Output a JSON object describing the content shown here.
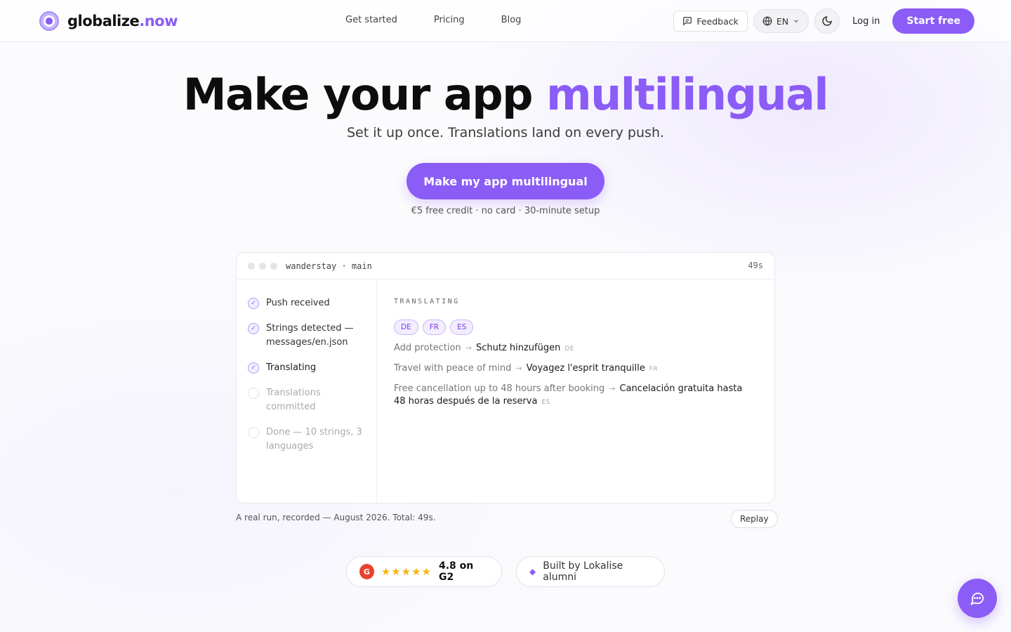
{
  "brand": {
    "name_main": "globalize",
    "name_accent": ".now"
  },
  "nav": {
    "items": [
      "Get started",
      "Pricing",
      "Blog"
    ]
  },
  "header": {
    "feedback_label": "Feedback",
    "lang_label": "EN",
    "login_label": "Log in",
    "start_label": "Start free"
  },
  "hero": {
    "title_main": "Make your app ",
    "title_accent": "multilingual",
    "subtitle": "Set it up once. Translations land on every push.",
    "cta_label": "Make my app multilingual",
    "cta_note": "€5 free credit · no card · 30-minute setup"
  },
  "demo": {
    "repo": "wanderstay · main",
    "timer": "49s",
    "steps": [
      {
        "label": "Push received",
        "state": "done"
      },
      {
        "label": "Strings detected — messages/en.json",
        "state": "done"
      },
      {
        "label": "Translating",
        "state": "active"
      },
      {
        "label": "Translations committed",
        "state": "pending"
      },
      {
        "label": "Done — 10 strings, 3 languages",
        "state": "pending"
      }
    ],
    "section_label": "TRANSLATING",
    "chips": [
      "DE",
      "FR",
      "ES"
    ],
    "translations": [
      {
        "src": "Add protection",
        "dst": "Schutz hinzufügen",
        "lang": "DE"
      },
      {
        "src": "Travel with peace of mind",
        "dst": "Voyagez l'esprit tranquille",
        "lang": "FR"
      },
      {
        "src": "Free cancellation up to 48 hours after booking",
        "dst": "Cancelación gratuita hasta 48 horas después de la reserva",
        "lang": "ES"
      }
    ],
    "caption": "A real run, recorded — August 2026. Total: 49s.",
    "replay_label": "Replay"
  },
  "badges": {
    "g2_logo": "G",
    "g2_stars": "★★★★★",
    "g2_rating": "4.8 on G2",
    "lokalise_text": "Built by Lokalise alumni"
  },
  "icons": {
    "feedback": "message-square-icon",
    "language": "globe-icon",
    "theme": "moon-icon",
    "chat": "chat-bubble-icon"
  },
  "colors": {
    "accent": "#8b5cf6",
    "g2_red": "#e8432e",
    "star": "#f5b50a"
  }
}
